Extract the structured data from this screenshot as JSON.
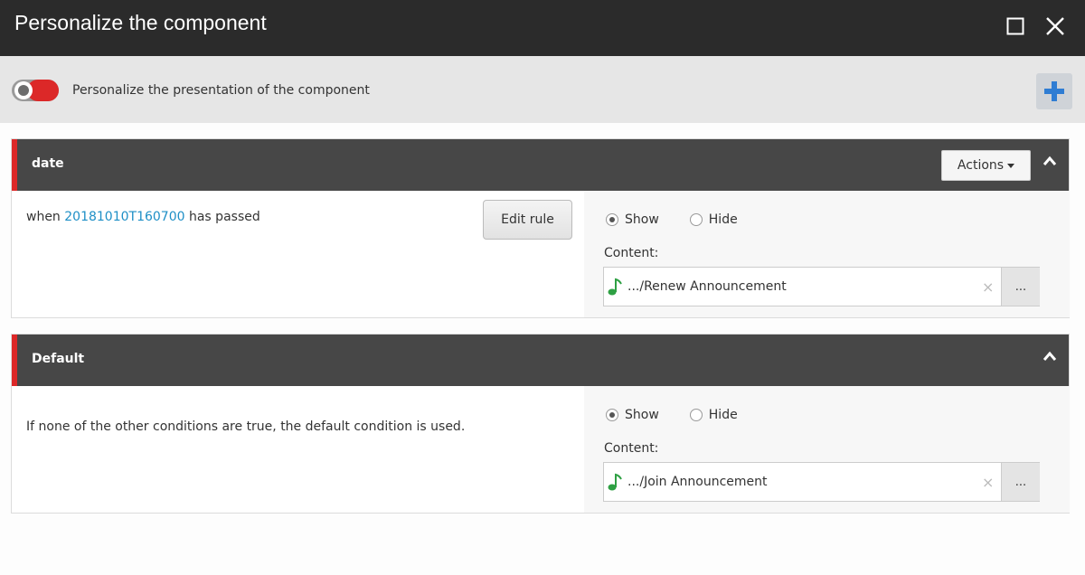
{
  "dialog": {
    "title": "Personalize the component"
  },
  "subheader": {
    "text": "Personalize the presentation of the component"
  },
  "rules": [
    {
      "name": "date",
      "actions_label": "Actions",
      "condition_prefix": "when",
      "condition_link": "20181010T160700",
      "condition_suffix": "has passed",
      "edit_label": "Edit rule",
      "show_label": "Show",
      "hide_label": "Hide",
      "selected": "Show",
      "content_label": "Content:",
      "content_value": ".../Renew Announcement",
      "clear_glyph": "×",
      "browse_label": "..."
    },
    {
      "name": "Default",
      "description": "If none of the other conditions are true, the default condition is used.",
      "show_label": "Show",
      "hide_label": "Hide",
      "selected": "Show",
      "content_label": "Content:",
      "content_value": ".../Join Announcement",
      "clear_glyph": "×",
      "browse_label": "..."
    }
  ],
  "colors": {
    "accent_red": "#dc2828",
    "link_blue": "#1e8fc6",
    "header_dark": "#474747",
    "add_blue": "#2f7dd3",
    "note_green": "#2ea043"
  }
}
